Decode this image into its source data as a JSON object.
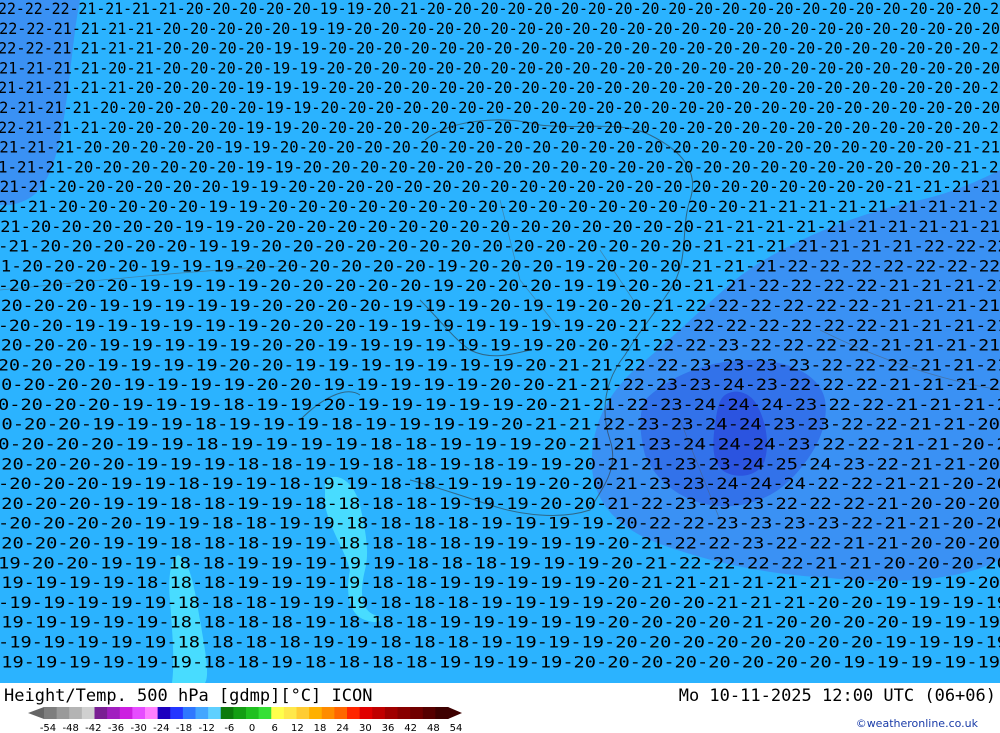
{
  "map": {
    "background_color": "#2bb3ff",
    "colors": {
      "t_minus_18": "#48dcff",
      "t_minus_22": "#3a91f4",
      "t_minus_23": "#3272ea",
      "t_minus_24": "#2b54e0"
    },
    "contour_label_rows": [
      "22-22-22-21-21-21-21-20-20-20-20-20-19-19-20-21-20-20-20-20-20-20-20-20-20-20-20-20-20-20-20-20-20-20-20-20-20-20",
      "-22-22-21-21-21-21-20-20-20-20-20-19-19-20-20-20-20-20-20-20-20-20-20-20-20-20-20-20-20-20-20-20-20-20-20-20-20",
      "22-22-21-21-21-21-20-20-20-20-19-19-20-20-20-20-20-20-20-20-20-20-20-20-20-20-20-20-20-20-20-20-20-20-20-20-20",
      "-21-21-21-21-20-21-20-20-20-20-19-19-20-20-20-20-20-20-20-20-20-20-20-20-20-20-20-20-20-20-20-20-20-20-20-20-20",
      "21-21-21-21-21-20-20-20-20-19-19-19-20-20-20-20-20-20-20-20-20-20-20-20-20-20-20-20-20-20-20-20-20-20-20-20-20",
      "22-21-21-21-20-20-20-20-20-20-19-19-20-20-20-20-20-20-20-20-20-20-20-20-20-20-20-20-20-20-20-20-20-20-20-20-20",
      "22-21-21-21-20-20-20-20-20-19-19-20-20-20-20-20-20-20-20-20-20-20-20-20-20-20-20-20-20-20-20-20-20-20-20-20-20",
      "-21-21-21-20-20-20-20-20-19-19-20-20-20-20-20-20-20-20-20-20-20-20-20-20-20-20-20-20-20-20-20-20-20-20-21-21",
      "1-21-21-20-20-20-20-20-20-19-19-20-20-20-20-20-20-20-20-20-20-20-20-20-20-20-20-20-20-20-20-20-20-20-21-21",
      "-21-21-20-20-20-20-20-20-19-19-20-20-20-20-20-20-20-20-20-20-20-20-20-20-20-20-20-20-20-20-20-21-21-21-21",
      "21-21-20-20-20-20-20-19-19-20-20-20-20-20-20-20-20-20-20-20-20-20-20-20-20-21-21-21-21-21-21-21-21-21",
      "-21-20-20-20-20-20-19-19-20-20-20-20-20-20-20-20-20-20-20-20-20-20-20-21-21-21-21-21-21-21-21-21-21",
      "-21-20-20-20-20-20-19-19-20-20-20-20-20-20-20-20-20-20-20-20-20-20-21-21-21-21-21-21-21-22-22-22",
      "21-20-20-20-20-19-19-19-20-20-20-20-20-20-19-20-20-20-19-20-20-20-21-21-21-22-22-22-22-22-22-22",
      "-20-20-20-20-19-19-19-19-20-20-20-20-20-19-20-20-20-19-19-20-20-21-21-22-22-22-22-21-21-21-21",
      "-20-20-20-19-19-19-19-19-20-20-20-20-19-19-19-20-19-19-20-20-21-22-22-22-22-22-22-21-21-21-21",
      "-20-20-19-19-19-19-19-19-20-20-20-19-19-19-19-19-19-19-20-21-22-22-22-22-22-22-22-21-21-21-21",
      "-20-20-20-19-19-19-19-19-20-20-19-19-19-19-19-19-19-20-20-21-22-22-23-22-22-22-22-21-21-21-21",
      "20-20-20-19-19-19-19-20-20-19-19-19-19-19-19-19-20-21-21-22-22-23-23-23-23-22-22-22-21-21-21",
      "20-20-20-20-19-19-19-19-20-20-19-19-19-19-19-20-20-21-21-22-23-23-24-23-22-22-22-21-21-21-2",
      "0-20-20-20-19-19-19-18-19-19-20-19-19-19-19-19-20-21-21-22-23-24-24-24-23-22-22-21-21-21-2",
      "20-20-20-19-19-19-18-19-19-19-18-19-19-19-19-20-21-21-22-23-23-24-24-23-23-22-22-21-21-20",
      "0-20-20-20-19-19-18-19-19-19-19-18-18-19-19-19-20-21-21-23-24-24-24-23-22-22-21-21-20-2",
      "-20-20-20-20-19-19-19-18-18-19-19-18-18-19-18-19-19-20-21-21-23-23-24-25-24-23-22-21-21-20",
      "-20-20-20-19-19-18-19-19-18-19-19-18-18-19-19-19-20-20-21-23-23-24-24-24-22-22-21-21-20-20",
      "-20-20-20-19-19-18-18-19-19-18-18-18-18-19-19-19-20-20-21-22-23-23-23-22-22-22-21-20-20-20",
      "-20-20-20-20-19-19-18-18-19-19-18-18-18-18-19-19-19-19-20-22-22-23-23-23-23-22-21-21-20-20",
      "-20-20-20-19-19-18-18-18-19-19-18-18-18-18-19-19-19-19-20-21-22-22-23-22-22-21-21-20-20-20",
      "19-20-20-19-19-18-18-19-19-19-19-19-18-18-18-19-19-19-20-21-22-22-22-22-21-21-20-20-20-20",
      "-19-19-19-19-18-18-18-19-19-19-19-18-18-19-19-19-19-19-20-21-21-21-21-21-21-20-20-19-19-20",
      "-19-19-19-19-19-18-18-18-19-19-19-18-18-18-19-19-19-19-20-20-20-21-21-21-20-20-19-19-19-19",
      "-19-19-19-19-19-18-18-18-18-19-18-18-18-19-19-19-19-19-20-20-20-20-21-20-20-20-20-19-19-19",
      "-19-19-19-19-19-18-18-18-18-19-19-18-18-18-19-19-19-19-20-20-20-20-20-20-20-20-19-19-19-19",
      "-19-19-19-19-19-19-18-18-19-18-18-18-18-19-19-19-19-20-20-20-20-20-20-20-20-19-19-19-19-19"
    ]
  },
  "footer": {
    "title": "Height/Temp. 500 hPa [gdmp][°C] ICON",
    "datetime": "Mo 10-11-2025 12:00 UTC (06+06)",
    "credit": "©weatheronline.co.uk"
  },
  "legend": {
    "ticks": [
      "-54",
      "-48",
      "-42",
      "-36",
      "-30",
      "-24",
      "-18",
      "-12",
      "-6",
      "0",
      "6",
      "12",
      "18",
      "24",
      "30",
      "36",
      "42",
      "48",
      "54"
    ],
    "colors": [
      "#7e7e7e",
      "#9a9a9a",
      "#b4b4b4",
      "#d0d0d0",
      "#7a1f93",
      "#a11fbf",
      "#cc1fe0",
      "#e64cff",
      "#ff7fff",
      "#1d00bf",
      "#2436ff",
      "#2f78ff",
      "#43a6ff",
      "#5fd0ff",
      "#0d7a0d",
      "#149e14",
      "#20c020",
      "#35e035",
      "#ffff4c",
      "#ffe84a",
      "#ffcc33",
      "#ffb000",
      "#ff8c00",
      "#ff6600",
      "#ff2600",
      "#e00000",
      "#c00000",
      "#a00000",
      "#880000",
      "#700000",
      "#560000",
      "#3e0000"
    ]
  }
}
